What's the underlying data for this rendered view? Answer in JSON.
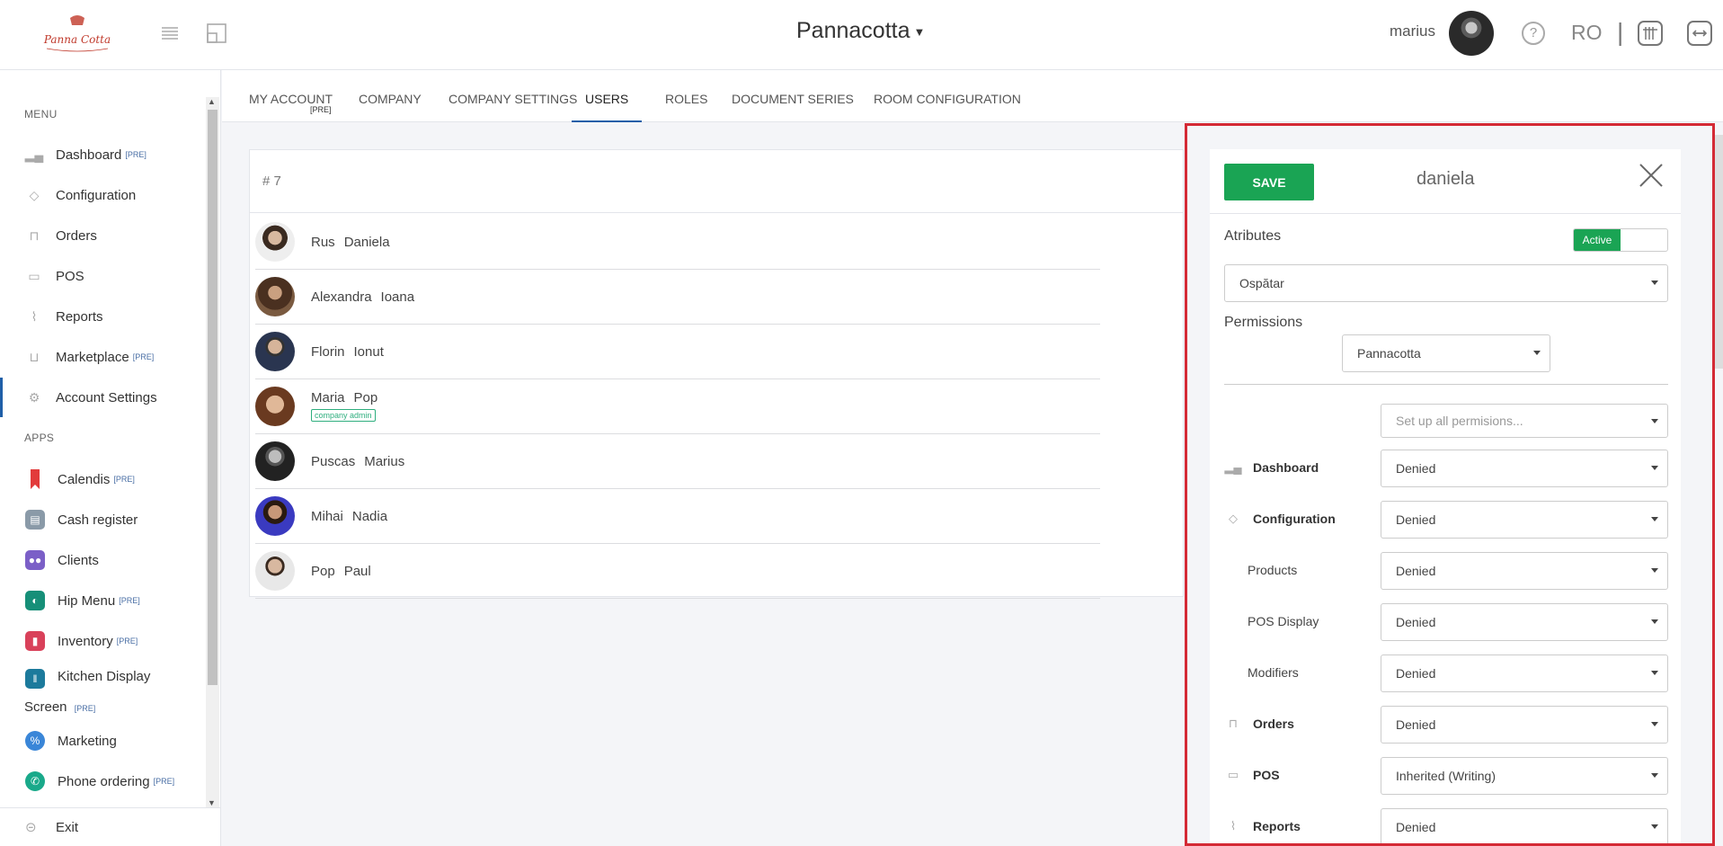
{
  "header": {
    "venue": "Pannacotta",
    "username": "marius",
    "language": "RO",
    "separator": "|"
  },
  "sidebar": {
    "menu_label": "MENU",
    "apps_label": "APPS",
    "pre_tag": "[PRE]",
    "menu_items": [
      {
        "label": "Dashboard",
        "pre": true,
        "icon": "bar-chart-icon"
      },
      {
        "label": "Configuration",
        "pre": false,
        "icon": "tag-icon"
      },
      {
        "label": "Orders",
        "pre": false,
        "icon": "bag-icon"
      },
      {
        "label": "POS",
        "pre": false,
        "icon": "monitor-icon"
      },
      {
        "label": "Reports",
        "pre": false,
        "icon": "line-chart-icon"
      },
      {
        "label": "Marketplace",
        "pre": true,
        "icon": "cart-icon"
      },
      {
        "label": "Account Settings",
        "pre": false,
        "icon": "gear-icon"
      }
    ],
    "apps": [
      {
        "label": "Calendis",
        "pre": true,
        "color": "#e23b3b"
      },
      {
        "label": "Cash register",
        "pre": false,
        "color": "#8a9aa8"
      },
      {
        "label": "Clients",
        "pre": false,
        "color": "#7b5fc7"
      },
      {
        "label": "Hip Menu",
        "pre": true,
        "color": "#168f78"
      },
      {
        "label": "Inventory",
        "pre": true,
        "color": "#d9415a"
      },
      {
        "label": "Kitchen Display",
        "label2": "Screen",
        "pre": true,
        "color": "#1c7a9c"
      },
      {
        "label": "Marketing",
        "pre": false,
        "color": "#3a86d8"
      },
      {
        "label": "Phone ordering",
        "pre": true,
        "color": "#19a98a"
      }
    ],
    "exit_label": "Exit"
  },
  "tabs": [
    {
      "label": "MY ACCOUNT",
      "sub": "[PRE]"
    },
    {
      "label": "COMPANY"
    },
    {
      "label": "COMPANY SETTINGS"
    },
    {
      "label": "USERS"
    },
    {
      "label": "ROLES"
    },
    {
      "label": "DOCUMENT SERIES"
    },
    {
      "label": "ROOM CONFIGURATION"
    }
  ],
  "users": {
    "count_label": "# 7",
    "list": [
      {
        "last": "Rus",
        "first": "Daniela"
      },
      {
        "last": "Alexandra",
        "first": "Ioana"
      },
      {
        "last": "Florin",
        "first": "Ionut"
      },
      {
        "last": "Maria",
        "first": "Pop",
        "badge": "company admin"
      },
      {
        "last": "Puscas",
        "first": "Marius"
      },
      {
        "last": "Mihai",
        "first": "Nadia"
      },
      {
        "last": "Pop",
        "first": "Paul"
      }
    ]
  },
  "panel": {
    "save_label": "SAVE",
    "title": "daniela",
    "attributes_label": "Atributes",
    "active_label": "Active",
    "role_value": "Ospătar",
    "permissions_label": "Permissions",
    "permissions_location": "Pannacotta",
    "setup_all_placeholder": "Set up all permisions...",
    "permissions": [
      {
        "label": "Dashboard",
        "value": "Denied",
        "bold": true,
        "icon": "bar-chart-icon"
      },
      {
        "label": "Configuration",
        "value": "Denied",
        "bold": true,
        "icon": "tag-icon"
      },
      {
        "label": "Products",
        "value": "Denied",
        "bold": false
      },
      {
        "label": "POS Display",
        "value": "Denied",
        "bold": false
      },
      {
        "label": "Modifiers",
        "value": "Denied",
        "bold": false
      },
      {
        "label": "Orders",
        "value": "Denied",
        "bold": true,
        "icon": "bag-icon"
      },
      {
        "label": "POS",
        "value": "Inherited (Writing)",
        "bold": true,
        "icon": "monitor-icon"
      },
      {
        "label": "Reports",
        "value": "Denied",
        "bold": true,
        "icon": "line-chart-icon"
      }
    ]
  }
}
